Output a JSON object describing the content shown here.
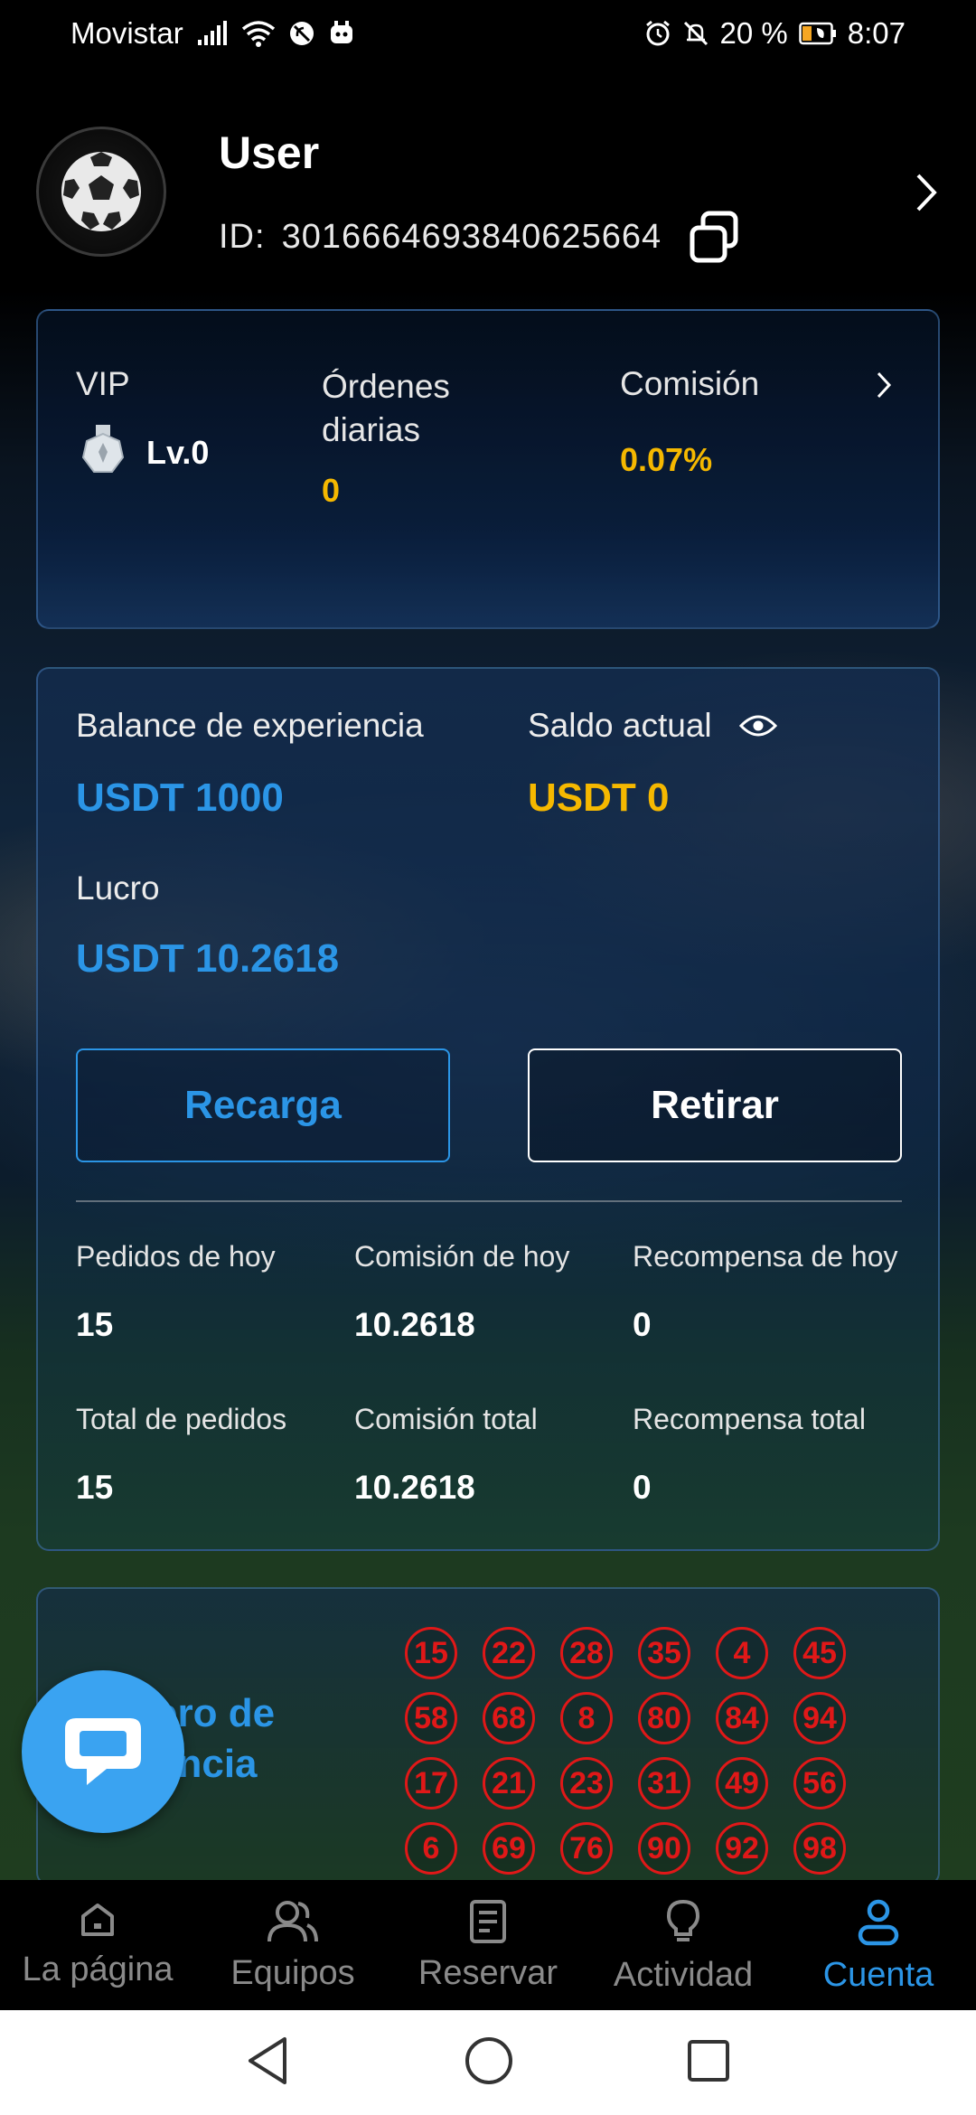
{
  "status_bar": {
    "carrier": "Movistar",
    "battery_percent": "20 %",
    "time": "8:07",
    "icons": [
      "signal-icon",
      "wifi-icon",
      "no-sync-icon",
      "app-notification-icon",
      "alarm-icon",
      "mute-icon",
      "battery-saver-icon"
    ]
  },
  "profile": {
    "name": "User",
    "id_label": "ID:",
    "id_value": "3016664693840625664"
  },
  "vip_card": {
    "vip_label": "VIP",
    "level": "Lv.0",
    "daily_orders_label": "Órdenes diarias",
    "daily_orders_value": "0",
    "commission_label": "Comisión",
    "commission_value": "0.07%"
  },
  "balance_card": {
    "experience_label": "Balance de experiencia",
    "experience_value": "USDT 1000",
    "current_label": "Saldo actual",
    "current_value": "USDT 0",
    "profit_label": "Lucro",
    "profit_value": "USDT 10.2618",
    "recharge_button": "Recarga",
    "withdraw_button": "Retirar",
    "stats": [
      {
        "label": "Pedidos de hoy",
        "value": "15"
      },
      {
        "label": "Comisión de hoy",
        "value": "10.2618"
      },
      {
        "label": "Recompensa de hoy",
        "value": "0"
      },
      {
        "label": "Total de pedidos",
        "value": "15"
      },
      {
        "label": "Comisión total",
        "value": "10.2618"
      },
      {
        "label": "Recompensa total",
        "value": "0"
      }
    ]
  },
  "lottery_card": {
    "title_visible": "ero de\nencia",
    "numbers": [
      "15",
      "22",
      "28",
      "35",
      "4",
      "45",
      "58",
      "68",
      "8",
      "80",
      "84",
      "94",
      "17",
      "21",
      "23",
      "31",
      "49",
      "56",
      "6",
      "69",
      "76",
      "90",
      "92",
      "98"
    ]
  },
  "bottom_nav": {
    "items": [
      {
        "label": "La página",
        "icon": "home-icon",
        "active": false
      },
      {
        "label": "Equipos",
        "icon": "team-icon",
        "active": false
      },
      {
        "label": "Reservar",
        "icon": "document-icon",
        "active": false
      },
      {
        "label": "Actividad",
        "icon": "lightbulb-icon",
        "active": false
      },
      {
        "label": "Cuenta",
        "icon": "user-icon",
        "active": true
      }
    ]
  },
  "colors": {
    "accent_blue": "#2b95e6",
    "gold": "#f5b800",
    "lottery_red": "#e01818",
    "chat_fab": "#3aa3f1"
  }
}
